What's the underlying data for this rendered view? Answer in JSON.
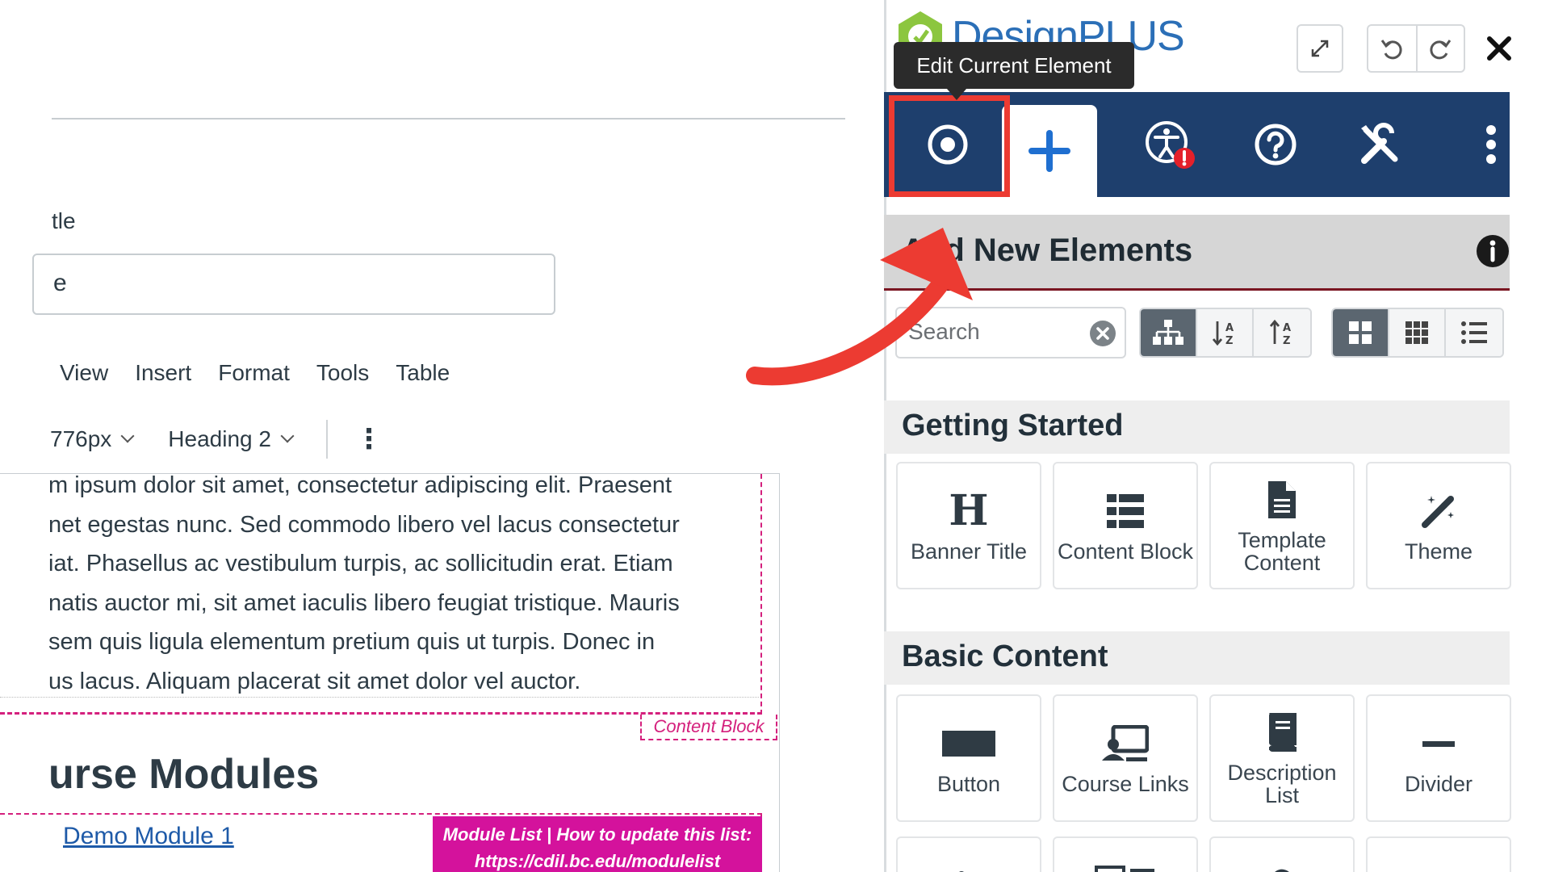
{
  "editor": {
    "title_label": "tle",
    "title_value": "e",
    "menu": [
      "View",
      "Insert",
      "Format",
      "Tools",
      "Table"
    ],
    "font_size": "776px",
    "block_format": "Heading 2",
    "paragraph_lines": [
      "m ipsum dolor sit amet, consectetur adipiscing elit. Praesent",
      "net egestas nunc. Sed commodo libero vel lacus consectetur",
      "iat. Phasellus ac vestibulum turpis, ac sollicitudin erat. Etiam",
      "natis auctor mi, sit amet iaculis libero feugiat tristique. Mauris",
      "sem quis ligula elementum pretium quis ut turpis. Donec in",
      "us lacus. Aliquam placerat sit amet dolor vel auctor."
    ],
    "content_block_tag": "Content Block",
    "modules_heading": "urse Modules",
    "module_link": "Demo Module 1",
    "module_badge_line1": "Module List | How to update this list:",
    "module_badge_line2": "https://cdil.bc.edu/modulelist"
  },
  "panel": {
    "brand": "DesignPLUS",
    "tooltip": "Edit Current Element",
    "section_title": "Add New Elements",
    "search_placeholder": "Search",
    "categories": [
      {
        "title": "Getting Started",
        "items": [
          {
            "label": "Banner Title",
            "icon": "heading-icon"
          },
          {
            "label": "Content Block",
            "icon": "list-icon"
          },
          {
            "label": "Template Content",
            "icon": "document-icon"
          },
          {
            "label": "Theme",
            "icon": "magic-wand-icon"
          }
        ]
      },
      {
        "title": "Basic Content",
        "items": [
          {
            "label": "Button",
            "icon": "button-icon"
          },
          {
            "label": "Course Links",
            "icon": "course-links-icon"
          },
          {
            "label": "Description List",
            "icon": "book-icon"
          },
          {
            "label": "Divider",
            "icon": "divider-icon"
          }
        ]
      }
    ]
  },
  "colors": {
    "tab_bar": "#1e3f6d",
    "highlight": "#ec3b32",
    "content_block": "#d4207d",
    "module_badge": "#d4129c",
    "link": "#1e5aa8",
    "brand": "#2b6fb7"
  }
}
